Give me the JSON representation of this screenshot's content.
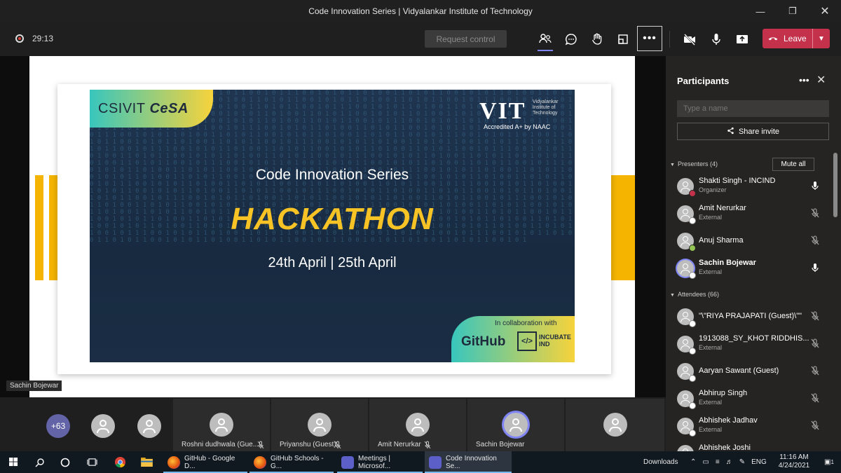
{
  "window": {
    "title": "Code Innovation Series | Vidyalankar Institute of Technology"
  },
  "toolbar": {
    "timer": "29:13",
    "request_control": "Request control",
    "more": "•••",
    "leave": "Leave"
  },
  "slide": {
    "csi_logo": "CSIVIT CeSA",
    "vit_logo": "VIT",
    "vit_name": "Vidyalankar Institute of Technology",
    "accreditation": "Accredited A+ by NAAC",
    "subtitle": "Code Innovation Series",
    "title": "HACKATHON",
    "dates": "24th April | 25th April",
    "collab_intro": "In collaboration with",
    "collab_github": "GitHub",
    "collab_incubate": "INCUBATE IND"
  },
  "stage": {
    "presenter_name": "Sachin Bojewar"
  },
  "panel": {
    "title": "Participants",
    "more": "•••",
    "search_placeholder": "Type a name",
    "share_invite": "Share invite",
    "presenters_label": "Presenters (4)",
    "mute_all": "Mute all",
    "presenters": [
      {
        "name": "Shakti Singh - INCIND",
        "role": "Organizer",
        "status": "busy",
        "mic": "on"
      },
      {
        "name": "Amit Nerurkar",
        "role": "External",
        "status": "offline",
        "mic": "off"
      },
      {
        "name": "Anuj Sharma",
        "role": "",
        "status": "available",
        "mic": "off"
      },
      {
        "name": "Sachin Bojewar",
        "role": "External",
        "status": "offline",
        "mic": "on"
      }
    ],
    "attendees_label": "Attendees (66)",
    "attendees": [
      {
        "name": "\"\\\"RIYA PRAJAPATI (Guest)\\\"\"",
        "role": "",
        "mic": "off"
      },
      {
        "name": "1913088_SY_KHOT RIDDHIS...",
        "role": "External",
        "mic": "off"
      },
      {
        "name": "Aaryan Sawant (Guest)",
        "role": "",
        "mic": "off"
      },
      {
        "name": "Abhirup Singh",
        "role": "External",
        "mic": "off"
      },
      {
        "name": "Abhishek Jadhav",
        "role": "External",
        "mic": "off"
      },
      {
        "name": "Abhishek Joshi",
        "role": "",
        "mic": "off"
      }
    ]
  },
  "strip": {
    "overflow_count": "+63",
    "tiles": [
      {
        "name": "Roshni dudhwala (Gue..."
      },
      {
        "name": "Priyanshu (Guest)"
      },
      {
        "name": "Amit Nerurkar"
      },
      {
        "name": "Sachin Bojewar"
      },
      {
        "name": ""
      }
    ]
  },
  "taskbar": {
    "apps": [
      {
        "label": "GitHub - Google D...",
        "icon": "firefox-icon"
      },
      {
        "label": "GitHub Schools - G...",
        "icon": "firefox-icon"
      },
      {
        "label": "Meetings | Microsof...",
        "icon": "teams-icon"
      },
      {
        "label": "Code Innovation Se...",
        "icon": "teams-icon"
      }
    ],
    "downloads": "Downloads",
    "language": "ENG",
    "time": "11:16 AM",
    "date": "4/24/2021",
    "notifications": "1"
  },
  "colors": {
    "leave": "#c4314b",
    "accent": "#6264a7",
    "hackathon": "#f7c325"
  }
}
